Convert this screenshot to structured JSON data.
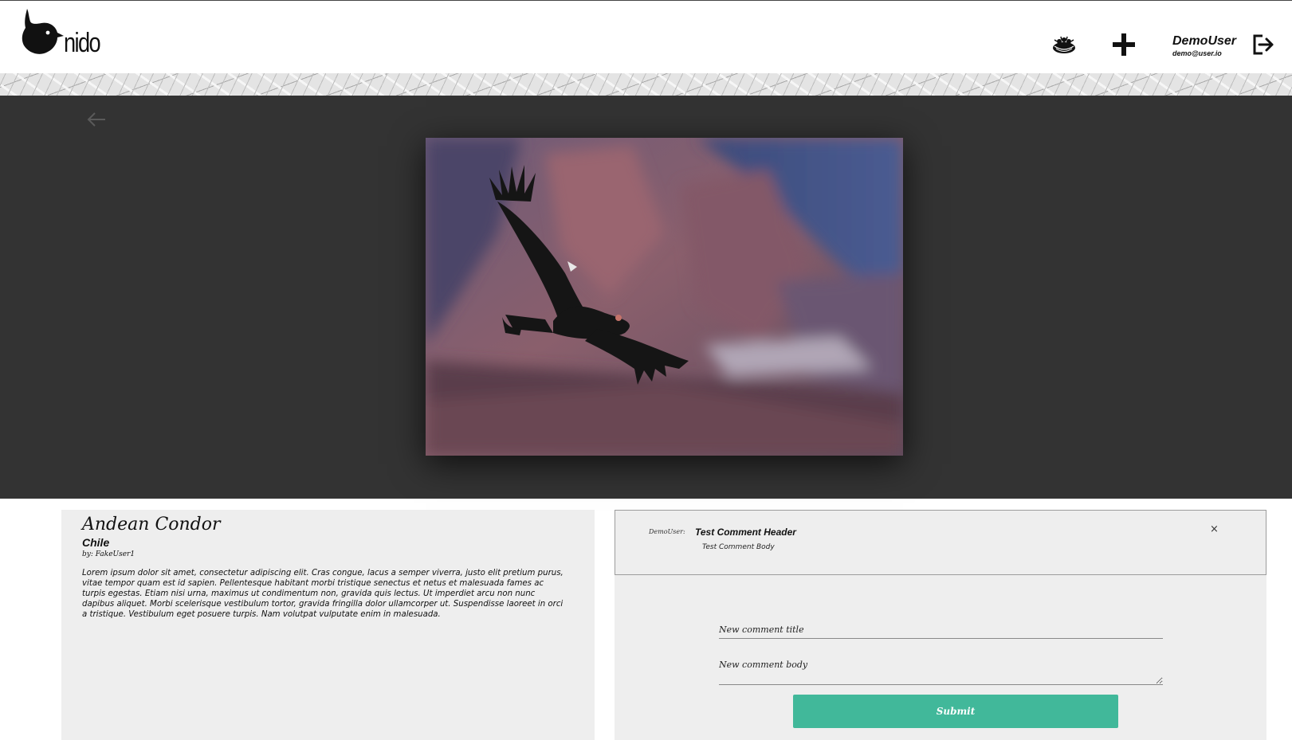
{
  "header": {
    "logo_text": "nido",
    "nav": {
      "nest_icon": "nest-icon",
      "add_icon": "plus-icon",
      "logout_icon": "logout-icon"
    },
    "user": {
      "name": "DemoUser",
      "email": "demo@user.io"
    }
  },
  "hero": {
    "back_icon": "arrow-left-icon",
    "photo_subject": "condor-photo"
  },
  "bird": {
    "name": "Andean Condor",
    "location": "Chile",
    "author": "by: FakeUser1",
    "description": "Lorem ipsum dolor sit amet, consectetur adipiscing elit. Cras congue, lacus a semper viverra, justo elit pretium purus, vitae tempor quam est id sapien. Pellentesque habitant morbi tristique senectus et netus et malesuada fames ac turpis egestas. Etiam nisi urna, maximus ut condimentum non, gravida quis lectus. Ut imperdiet arcu non nunc dapibus aliquet. Morbi scelerisque vestibulum tortor, gravida fringilla dolor ullamcorper ut. Suspendisse laoreet in orci a tristique. Vestibulum eget posuere turpis. Nam volutpat vulputate enim in malesuada."
  },
  "comments": [
    {
      "user": "DemoUser:",
      "title": "Test Comment Header",
      "body": "Test Comment Body",
      "close": "×"
    }
  ],
  "new_comment": {
    "title_placeholder": "New comment title",
    "body_placeholder": "New comment body",
    "submit_label": "Submit"
  },
  "colors": {
    "hero_bg": "#333333",
    "panel_bg": "#eeeeee",
    "submit_bg": "#41b89a"
  }
}
